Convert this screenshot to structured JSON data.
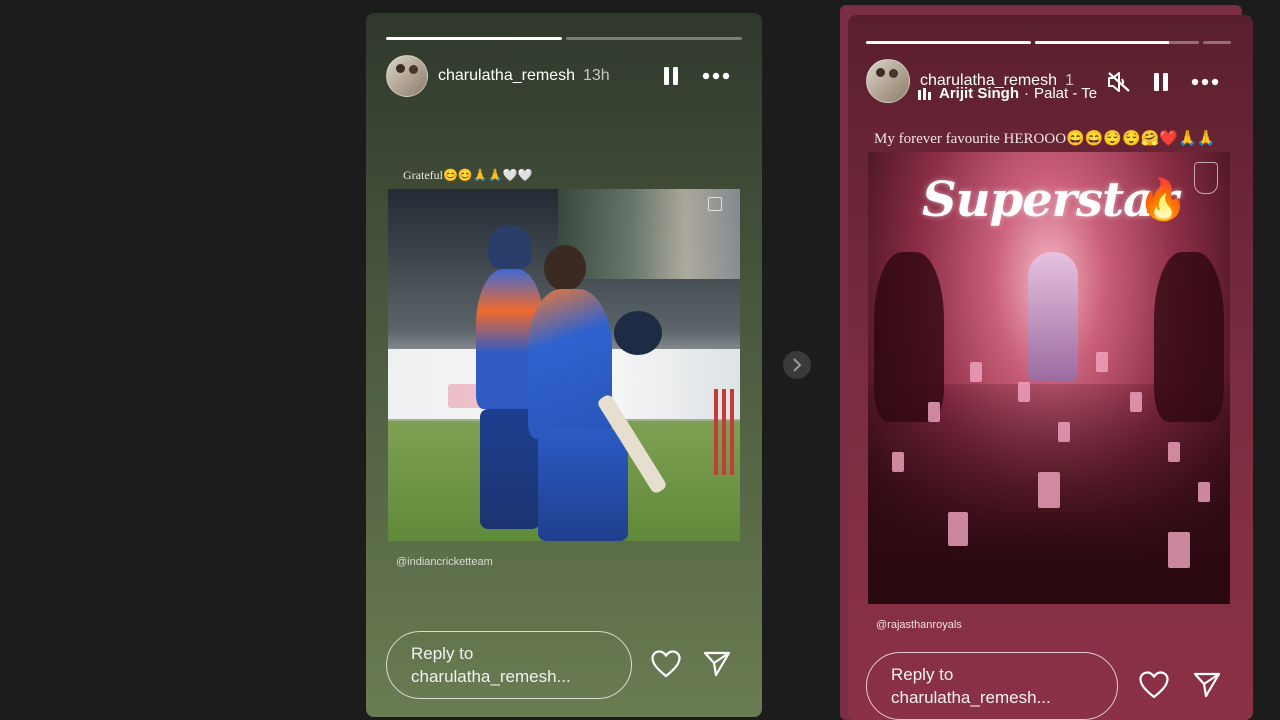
{
  "story1": {
    "username": "charulatha_remesh",
    "time": "13h",
    "caption": "Grateful😊😊🙏🙏🤍🤍",
    "mention": "@indiancricketteam",
    "reply_line1": "Reply to",
    "reply_line2": "charulatha_remesh...",
    "progress": [
      1.0,
      0.0
    ]
  },
  "story2": {
    "username": "charulatha_remesh",
    "time": "1",
    "music_artist": "Arijit Singh",
    "music_song": "Palat - Te",
    "caption": "My forever favourite HEROOO😄😄😌😌🤗❤️🙏🙏",
    "poster_title": "Superstar",
    "mention": "@rajasthanroyals",
    "reply_line1": "Reply to",
    "reply_line2": "charulatha_remesh...",
    "progress": [
      1.0,
      0.9,
      0.0
    ]
  },
  "icons": [
    "pause-icon",
    "more-icon",
    "heart-icon",
    "send-icon",
    "mute-icon",
    "chevron-right-icon",
    "music-bars-icon"
  ]
}
